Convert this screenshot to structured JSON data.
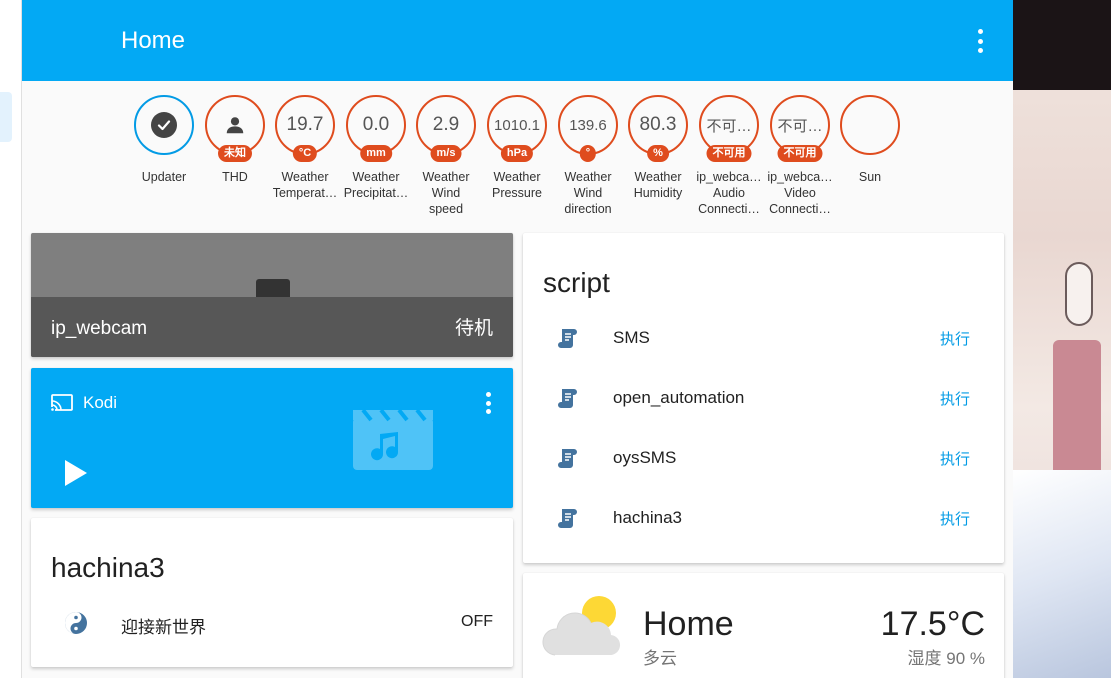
{
  "toolbar": {
    "title": "Home"
  },
  "badges": [
    {
      "value": "",
      "unit": "",
      "label": [
        "Updater"
      ],
      "icon": "check-circle-icon",
      "color": "#039be5"
    },
    {
      "value": "",
      "unit": "未知",
      "label": [
        "THD"
      ],
      "icon": "person-icon",
      "color": "#df4c1e"
    },
    {
      "value": "19.7",
      "unit": "°C",
      "label": [
        "Weather",
        "Temperat…"
      ]
    },
    {
      "value": "0.0",
      "unit": "mm",
      "label": [
        "Weather",
        "Precipitat…"
      ]
    },
    {
      "value": "2.9",
      "unit": "m/s",
      "label": [
        "Weather",
        "Wind",
        "speed"
      ]
    },
    {
      "value": "1010.1",
      "unit": "hPa",
      "label": [
        "Weather",
        "Pressure"
      ]
    },
    {
      "value": "139.6",
      "unit": "°",
      "label": [
        "Weather",
        "Wind",
        "direction"
      ]
    },
    {
      "value": "80.3",
      "unit": "%",
      "label": [
        "Weather",
        "Humidity"
      ]
    },
    {
      "value": "不可…",
      "unit": "不可用",
      "label": [
        "ip_webca…",
        "Audio",
        "Connecti…"
      ]
    },
    {
      "value": "不可…",
      "unit": "不可用",
      "label": [
        "ip_webca…",
        "Video",
        "Connecti…"
      ]
    },
    {
      "value": "",
      "unit": "",
      "label": [
        "Sun"
      ],
      "icon": "moon-icon"
    }
  ],
  "camera": {
    "name": "ip_webcam",
    "state": "待机"
  },
  "kodi": {
    "name": "Kodi"
  },
  "hachina": {
    "title": "hachina3",
    "rows": [
      {
        "label": "迎接新世界",
        "state": "OFF",
        "icon": "yin-yang-icon"
      }
    ]
  },
  "script": {
    "title": "script",
    "rows": [
      {
        "label": "SMS",
        "action": "执行"
      },
      {
        "label": "open_automation",
        "action": "执行"
      },
      {
        "label": "oysSMS",
        "action": "执行"
      },
      {
        "label": "hachina3",
        "action": "执行"
      }
    ]
  },
  "weather": {
    "location": "Home",
    "condition": "多云",
    "temperature": "17.5°C",
    "humidity": "湿度 90 %"
  },
  "colors": {
    "accent": "#03a9f4",
    "badge": "#df4c1e",
    "link": "#039be5"
  }
}
